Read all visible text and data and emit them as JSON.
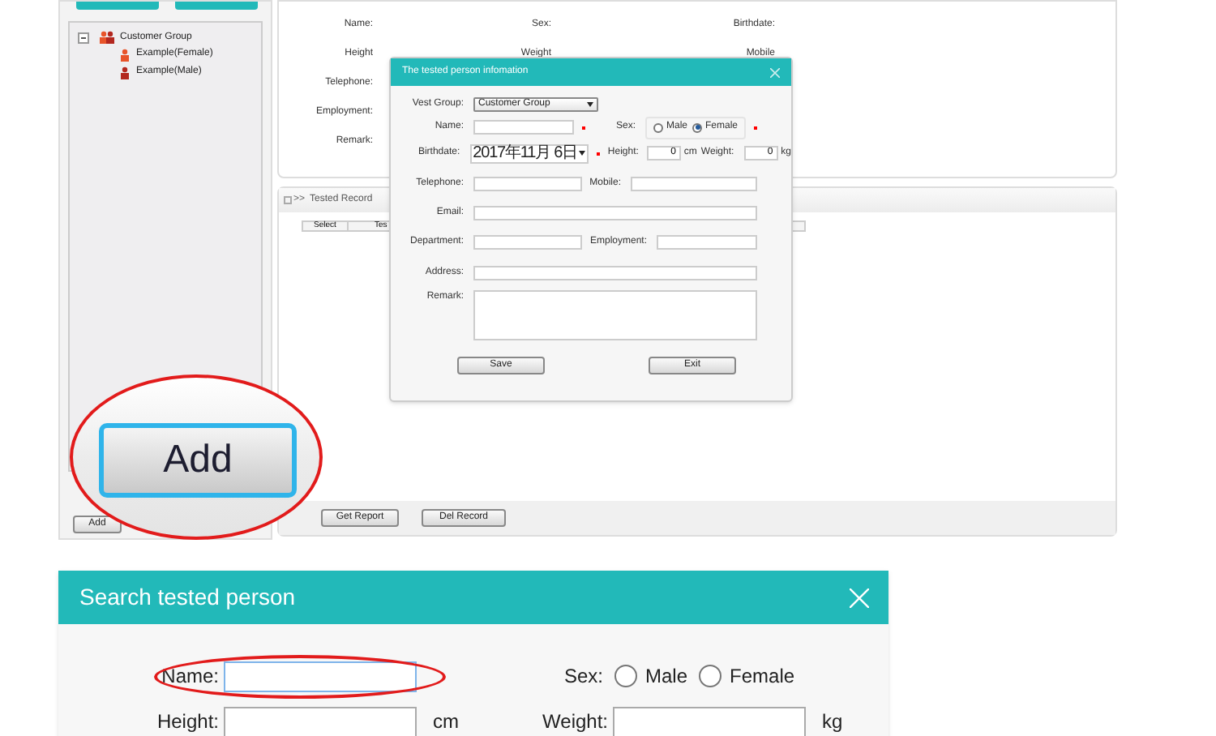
{
  "tree": {
    "label": "Customer Group",
    "expanded": true,
    "children": [
      {
        "label": "Example(Female)",
        "kind": "female"
      },
      {
        "label": "Example(Male)",
        "kind": "male"
      }
    ]
  },
  "left_buttons": [
    "Add"
  ],
  "details": {
    "rows": [
      [
        "Name:",
        "Sex:",
        "Birthdate:"
      ],
      [
        "Height",
        "Weight",
        "Mobile"
      ],
      [
        "Telephone:"
      ],
      [
        "Employment:"
      ],
      [
        "Remark:"
      ]
    ]
  },
  "records": {
    "marker": ">>",
    "title": "Tested Record",
    "columns": [
      "Select",
      "Tes"
    ],
    "buttons": [
      "Get Report",
      "Del Record"
    ]
  },
  "dialog": {
    "title": "The tested person infomation",
    "vest_group": {
      "label": "Vest Group:",
      "value": "Customer Group"
    },
    "name": {
      "label": "Name:",
      "required": true
    },
    "sex": {
      "label": "Sex:",
      "required": true,
      "options": [
        {
          "label": "Male",
          "selected": false
        },
        {
          "label": "Female",
          "selected": true
        }
      ]
    },
    "birthdate": {
      "label": "Birthdate:",
      "value": "2017年11月 6日",
      "required": true
    },
    "height": {
      "label": "Height:",
      "value": "0",
      "unit": "cm"
    },
    "weight": {
      "label": "Weight:",
      "value": "0",
      "unit": "kg"
    },
    "telephone": {
      "label": "Telephone:"
    },
    "mobile": {
      "label": "Mobile:"
    },
    "email": {
      "label": "Email:"
    },
    "department": {
      "label": "Department:"
    },
    "employment": {
      "label": "Employment:"
    },
    "address": {
      "label": "Address:"
    },
    "remark": {
      "label": "Remark:"
    },
    "buttons": [
      "Save",
      "Exit"
    ]
  },
  "callout": {
    "button": "Add"
  },
  "search_dialog": {
    "title": "Search tested person",
    "name": {
      "label": "Name:"
    },
    "sex": {
      "label": "Sex:",
      "options": [
        {
          "label": "Male",
          "selected": false
        },
        {
          "label": "Female",
          "selected": false
        }
      ]
    },
    "height": {
      "label": "Height:",
      "unit": "cm"
    },
    "weight": {
      "label": "Weight:",
      "unit": "kg"
    }
  }
}
